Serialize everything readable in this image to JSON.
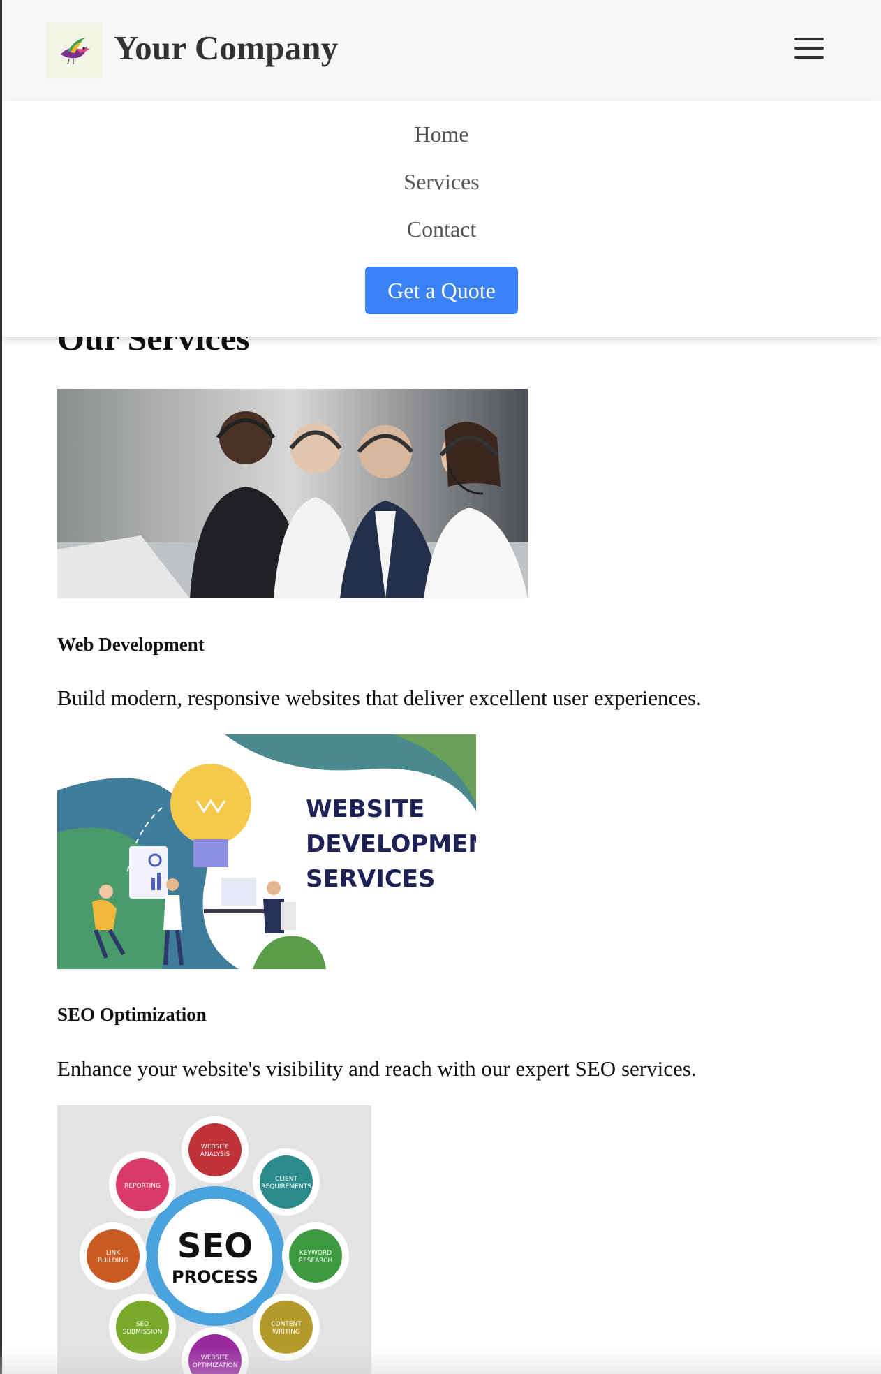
{
  "header": {
    "brand": "Your Company",
    "logo_icon": "bird-logo-icon",
    "menu_icon": "hamburger-menu-icon"
  },
  "nav": {
    "items": [
      {
        "label": "Home"
      },
      {
        "label": "Services"
      },
      {
        "label": "Contact"
      }
    ],
    "cta_label": "Get a Quote",
    "cta_color": "#3b82f6"
  },
  "main": {
    "section_title": "Our Services",
    "services": [
      {
        "image": "customer-support-team-image",
        "title": "Web Development",
        "description": "Build modern, responsive websites that deliver excellent user experiences."
      },
      {
        "image": "website-development-services-image",
        "image_text": [
          "WEBSITE",
          "DEVELOPMENT",
          "SERVICES"
        ],
        "title": "SEO Optimization",
        "description": "Enhance your website's visibility and reach with our expert SEO services."
      },
      {
        "image": "seo-process-image",
        "image_text": {
          "center_top": "SEO",
          "center_bottom": "PROCESS",
          "bubbles": [
            "WEBSITE ANALYSIS",
            "CLIENT REQUIREMENTS",
            "KEYWORD RESEARCH",
            "CONTENT WRITING",
            "WEBSITE OPTIMIZATION",
            "SEO SUBMISSION",
            "LINK BUILDING",
            "REPORTING"
          ]
        }
      }
    ]
  }
}
